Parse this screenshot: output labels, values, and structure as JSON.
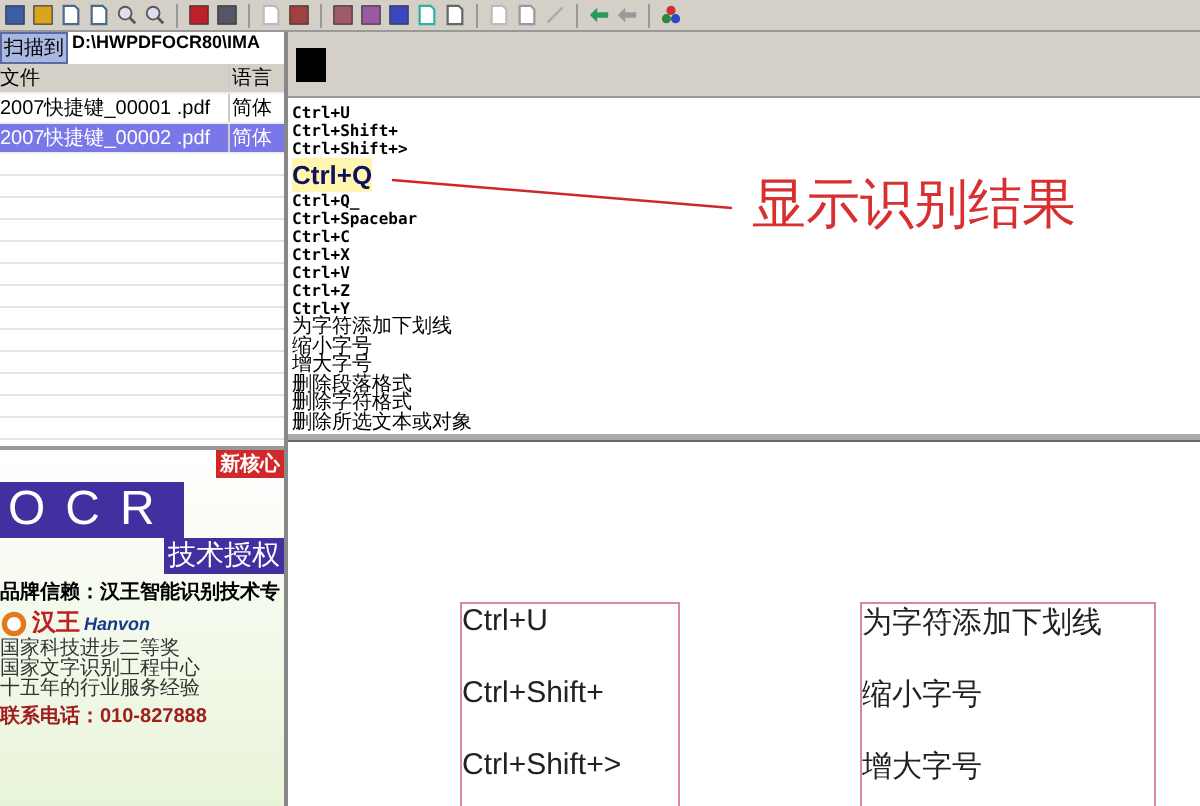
{
  "file_panel": {
    "scan_label": "扫描到",
    "path": "D:\\HWPDFOCR80\\IMA",
    "columns": [
      "文件",
      "语言"
    ],
    "rows": [
      {
        "file": "2007快捷键_00001 .pdf",
        "language": "简体",
        "selected": false
      },
      {
        "file": "2007快捷键_00002 .pdf",
        "language": "简体",
        "selected": true
      }
    ]
  },
  "ad": {
    "badge": "新核心",
    "headline": "OCR",
    "subtitle": "技术授权",
    "brand_line": "品牌信赖：汉王智能识别技术专",
    "logo_cn": "汉王",
    "logo_en": "Hanvon",
    "awards": [
      "国家科技进步二等奖",
      "国家文字识别工程中心",
      "十五年的行业服务经验"
    ],
    "phone": "联系电话：010-827888"
  },
  "recognized_text": {
    "lines": [
      {
        "text": "Ctrl+U",
        "highlighted": false
      },
      {
        "text": "Ctrl+Shift+",
        "highlighted": false
      },
      {
        "text": "Ctrl+Shift+>",
        "highlighted": false
      },
      {
        "text": "Ctrl+Q",
        "highlighted": true
      },
      {
        "text": "Ctrl+Q_",
        "highlighted": false
      },
      {
        "text": "Ctrl+Spacebar",
        "highlighted": false
      },
      {
        "text": "Ctrl+C",
        "highlighted": false
      },
      {
        "text": "Ctrl+X",
        "highlighted": false
      },
      {
        "text": "Ctrl+V",
        "highlighted": false
      },
      {
        "text": "Ctrl+Z",
        "highlighted": false
      },
      {
        "text": "Ctrl+Y",
        "highlighted": false
      },
      {
        "text": "为字符添加下划线",
        "highlighted": false
      },
      {
        "text": "缩小字号",
        "highlighted": false
      },
      {
        "text": "增大字号",
        "highlighted": false
      },
      {
        "text": "删除段落格式",
        "highlighted": false
      },
      {
        "text": "删除字符格式",
        "highlighted": false
      },
      {
        "text": "删除所选文本或对象",
        "highlighted": false
      }
    ]
  },
  "annotation": "显示识别结果",
  "page_blocks": [
    {
      "lines": [
        "Ctrl+U",
        "Ctrl+Shift+",
        "Ctrl+Shift+>"
      ]
    },
    {
      "lines": [
        "为字符添加下划线",
        "缩小字号",
        "增大字号"
      ]
    }
  ]
}
